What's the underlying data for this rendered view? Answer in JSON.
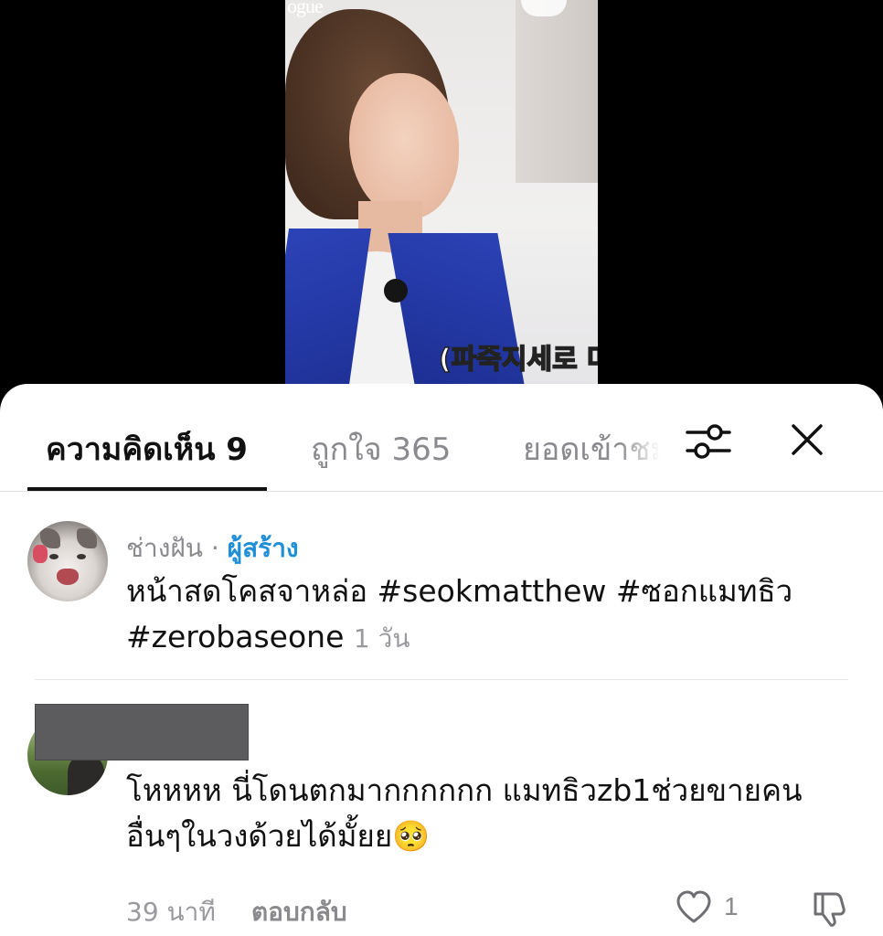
{
  "video": {
    "logo_text": "ogue",
    "subtitle": "(파죽지세로 마"
  },
  "tabs": {
    "comments": "ความคิดเห็น 9",
    "likes": "ถูกใจ 365",
    "views": "ยอดเข้าชม",
    "active": "comments"
  },
  "icons": {
    "filter": "sliders-filter-icon",
    "close": "close-icon",
    "like": "heart-outline-icon",
    "dislike": "thumbs-down-icon",
    "emoji": "pleading-face-emoji"
  },
  "colors": {
    "creator_tag": "#1f8fd8",
    "muted_text": "#8a8a8e",
    "primary_text": "#111111"
  },
  "comments": [
    {
      "username": "ช่างฝัน",
      "separator": " · ",
      "creator_tag": "ผู้สร้าง",
      "text": "หน้าสดโคสจาหล่อ #seokmatthew #ซอกแมทธิว #zerobaseone",
      "time": "1 วัน"
    },
    {
      "username_redacted": true,
      "text": "โหหหห นี่โดนตกมากกกกกก แมทธิวzb1ช่วยขายคนอื่นๆในวงด้วยได้มั้ยย",
      "emoji": "🥺",
      "time": "39 นาที",
      "reply_label": "ตอบกลับ",
      "like_count": "1"
    }
  ]
}
